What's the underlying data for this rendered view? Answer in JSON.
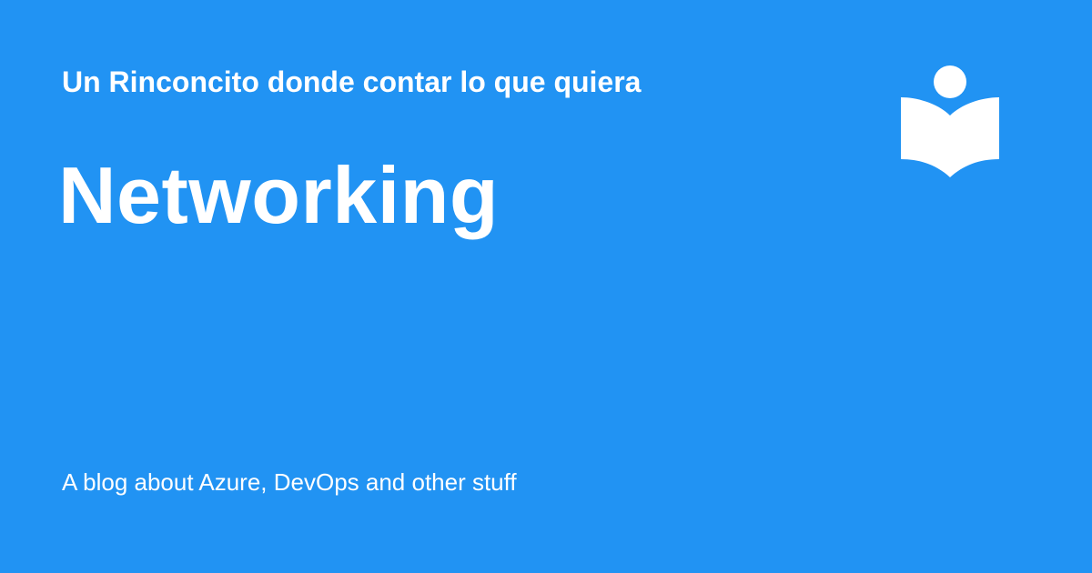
{
  "header": {
    "site_name": "Un Rinconcito donde contar lo que quiera"
  },
  "main": {
    "title": "Networking"
  },
  "footer": {
    "tagline": "A blog about Azure, DevOps and other stuff"
  },
  "logo": {
    "icon": "book-reader-icon"
  },
  "colors": {
    "background": "#2193f3",
    "foreground": "#ffffff"
  }
}
